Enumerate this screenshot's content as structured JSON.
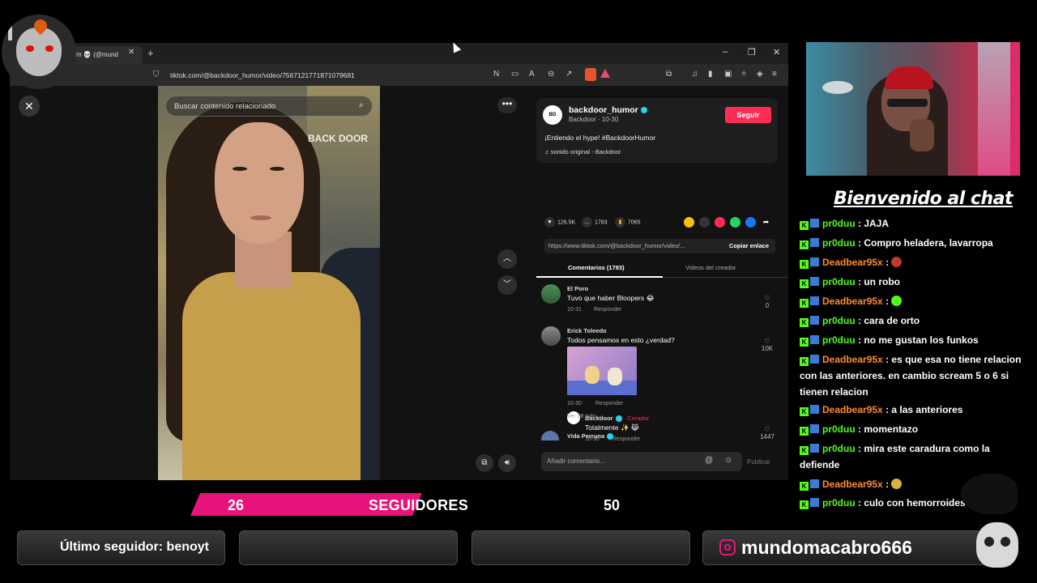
{
  "browser": {
    "tab_title": "m 💀 (@mund",
    "url": "tiktok.com/@backdoor_humor/video/7567121771871079681",
    "window_controls": {
      "minimize": "–",
      "restore": "❐",
      "close": "✕"
    }
  },
  "video": {
    "search_placeholder": "Buscar contenido relacionado",
    "watermark": "BACK DOOR"
  },
  "post": {
    "username": "backdoor_humor",
    "nickname_date": "Backdoor · 10-30",
    "follow_label": "Seguir",
    "description": "¡Entiendo el hype! #BackdoorHumor",
    "sound": "sonido original - Backdoor",
    "likes": "126.5K",
    "comments": "1783",
    "saves": "7065",
    "link": "https://www.tiktok.com/@backdoor_humor/video/...",
    "copy_link_label": "Copiar enlace",
    "tab_comments": "Comentarios (1783)",
    "tab_creator": "Videos del creador"
  },
  "comments": [
    {
      "name": "El Poro",
      "text": "Tuvo que haber Bloopers 😂",
      "date": "10-31",
      "reply": "Responder",
      "likes": "0"
    },
    {
      "name": "Erick Toleedo",
      "text": "Todos pensamos en esto ¿verdad?",
      "date": "10-30",
      "reply": "Responder",
      "likes": "10K"
    },
    {
      "name": "Backdoor",
      "creator_tag": "· Creador",
      "text": "Totalmente ✨ 😹",
      "date": "10-30",
      "reply": "Responder",
      "likes": "1447"
    },
    {
      "name": "Vida Perruna"
    }
  ],
  "see_more": "Ver 68 más ⌄",
  "comment_input_placeholder": "Añadir comentario...",
  "publish_label": "Publicar",
  "chat": {
    "title": "Bienvenido al chat",
    "messages": [
      {
        "user": "pr0duu",
        "color": "green",
        "text": ": JAJA"
      },
      {
        "user": "pr0duu",
        "color": "green",
        "text": ": Compro heladera, lavarropa"
      },
      {
        "user": "Deadbear95x",
        "color": "orange",
        "text": ":"
      },
      {
        "user": "pr0duu",
        "color": "green",
        "text": ": un robo"
      },
      {
        "user": "Deadbear95x",
        "color": "orange",
        "text": ":"
      },
      {
        "user": "pr0duu",
        "color": "green",
        "text": ": cara de orto"
      },
      {
        "user": "pr0duu",
        "color": "green",
        "text": ": no me gustan los funkos"
      },
      {
        "user": "Deadbear95x",
        "color": "orange",
        "text": ": es que esa no tiene relacion con las anteriores. en cambio scream 5 o 6 si tienen relacion"
      },
      {
        "user": "Deadbear95x",
        "color": "orange",
        "text": ": a las anteriores"
      },
      {
        "user": "pr0duu",
        "color": "green",
        "text": ": momentazo"
      },
      {
        "user": "pr0duu",
        "color": "green",
        "text": ": mira este caradura como la defiende"
      },
      {
        "user": "Deadbear95x",
        "color": "orange",
        "text": ":"
      },
      {
        "user": "pr0duu",
        "color": "green",
        "text": ": culo con hemorroides"
      }
    ]
  },
  "followers_goal": {
    "current": "26",
    "label": "SEGUIDORES",
    "goal": "50",
    "progress_fraction": 0.52
  },
  "bottom": {
    "last_follower": "Último seguidor: benoyt",
    "instagram": "mundomacabro666"
  },
  "colors": {
    "accent_pink": "#e8137a",
    "tiktok_red": "#fe2c55",
    "chat_green": "#53fc18",
    "chat_orange": "#ff8c2e"
  }
}
